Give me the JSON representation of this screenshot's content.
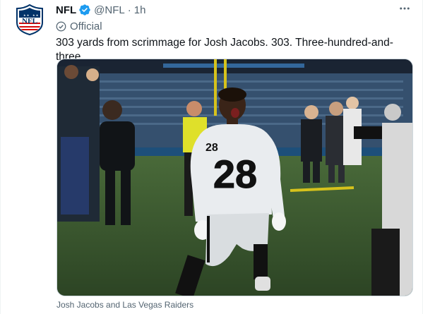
{
  "tweet": {
    "author_name": "NFL",
    "handle": "@NFL",
    "separator": "·",
    "time": "1h",
    "label": "Official",
    "text": "303 yards from scrimmage for Josh Jacobs. 303. Three-hundred-and-three.",
    "media_caption": "Josh Jacobs and Las Vegas Raiders",
    "more_icon": "more-horizontal-icon",
    "verified_icon": "verified-badge-icon",
    "official_icon": "government-official-icon"
  },
  "avatar": {
    "logo_text": "NFL",
    "icon": "nfl-shield-logo"
  },
  "media": {
    "jersey_number": "28",
    "description_icon": "photo-image"
  },
  "colors": {
    "text": "#0f1419",
    "secondary": "#536471",
    "verified": "#1d9bf0",
    "nfl_navy": "#013369",
    "nfl_red": "#d50a0a",
    "border": "#cfd9de"
  }
}
